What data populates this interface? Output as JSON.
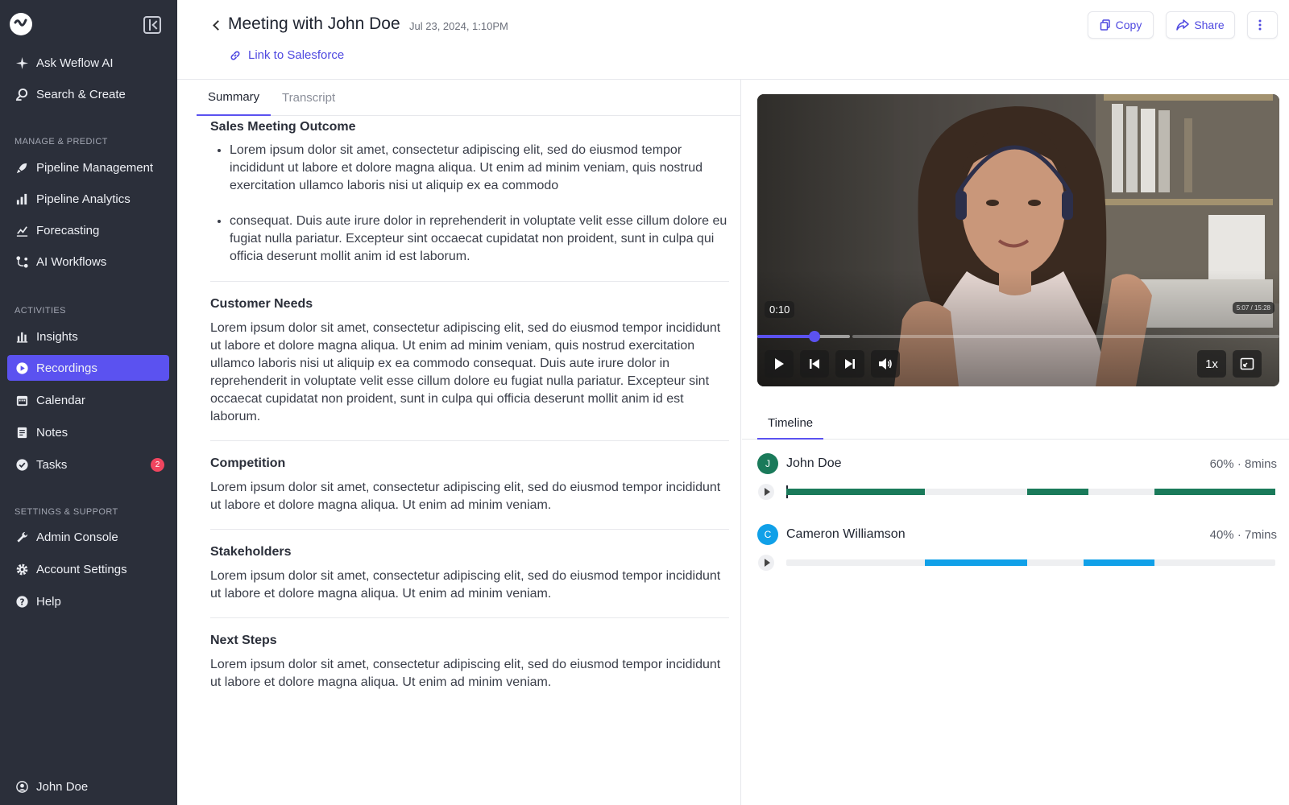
{
  "brand": {
    "accent": "#5b52f0",
    "sidebar_bg": "#2b2f3a"
  },
  "sidebar": {
    "top_items": [
      {
        "label": "Ask Weflow AI",
        "icon": "sparkle-icon"
      },
      {
        "label": "Search & Create",
        "icon": "search-create-icon"
      }
    ],
    "section_manage": "MANAGE & PREDICT",
    "manage_items": [
      {
        "label": "Pipeline Management",
        "icon": "rocket-icon"
      },
      {
        "label": "Pipeline Analytics",
        "icon": "analytics-icon"
      },
      {
        "label": "Forecasting",
        "icon": "forecast-icon"
      },
      {
        "label": "AI Workflows",
        "icon": "workflow-icon"
      }
    ],
    "section_activities": "ACTIVITIES",
    "activity_items": [
      {
        "label": "Insights",
        "icon": "bar-chart-icon"
      },
      {
        "label": "Recordings",
        "icon": "play-circle-icon",
        "active": true
      },
      {
        "label": "Calendar",
        "icon": "calendar-icon"
      },
      {
        "label": "Notes",
        "icon": "notes-icon"
      },
      {
        "label": "Tasks",
        "icon": "check-circle-icon",
        "badge": "2"
      }
    ],
    "section_settings": "SETTINGS & SUPPORT",
    "settings_items": [
      {
        "label": "Admin Console",
        "icon": "wrench-icon"
      },
      {
        "label": "Account Settings",
        "icon": "gear-icon"
      },
      {
        "label": "Help",
        "icon": "help-icon"
      }
    ],
    "user": "John Doe"
  },
  "header": {
    "title": "Meeting with John Doe",
    "date": "Jul 23, 2024, 1:10PM",
    "link": "Link to Salesforce",
    "copy_label": "Copy",
    "share_label": "Share"
  },
  "tabs": {
    "summary": "Summary",
    "transcript": "Transcript"
  },
  "summary": {
    "outcome_title": "Sales Meeting Outcome",
    "outcome_bullets": [
      "Lorem ipsum dolor sit amet, consectetur adipiscing elit, sed do eiusmod tempor incididunt ut labore et dolore magna aliqua. Ut enim ad minim veniam, quis nostrud exercitation ullamco laboris nisi ut aliquip ex ea commodo",
      "consequat. Duis aute irure dolor in reprehenderit in voluptate velit esse cillum dolore eu fugiat nulla pariatur. Excepteur sint occaecat cupidatat non proident, sunt in culpa qui officia deserunt mollit anim id est laborum."
    ],
    "needs_title": "Customer Needs",
    "needs_text": "Lorem ipsum dolor sit amet, consectetur adipiscing elit, sed do eiusmod tempor incididunt ut labore et dolore magna aliqua. Ut enim ad minim veniam, quis nostrud exercitation ullamco laboris nisi ut aliquip ex ea commodo consequat. Duis aute irure dolor in reprehenderit in voluptate velit esse cillum dolore eu fugiat nulla pariatur. Excepteur sint occaecat cupidatat non proident, sunt in culpa qui officia deserunt mollit anim id est laborum.",
    "competition_title": "Competition",
    "competition_text": "Lorem ipsum dolor sit amet, consectetur adipiscing elit, sed do eiusmod tempor incididunt ut labore et dolore magna aliqua. Ut enim ad minim veniam.",
    "stakeholders_title": "Stakeholders",
    "stakeholders_text": "Lorem ipsum dolor sit amet, consectetur adipiscing elit, sed do eiusmod tempor incididunt ut labore et dolore magna aliqua. Ut enim ad minim veniam.",
    "next_title": "Next Steps",
    "next_text": "Lorem ipsum dolor sit amet, consectetur adipiscing elit, sed do eiusmod tempor incididunt ut labore et dolore magna aliqua. Ut enim ad minim veniam."
  },
  "video": {
    "current_time": "0:10",
    "duration": "5:07 / 15:28",
    "speed": "1x",
    "progress": 0.11
  },
  "timeline": {
    "tab": "Timeline",
    "speakers": [
      {
        "initial": "J",
        "name": "John Doe",
        "stat": "60% · 8mins",
        "color": "#1a7a5a",
        "segments": [
          [
            0.0,
            0.283
          ],
          [
            0.493,
            0.618
          ],
          [
            0.753,
            1.0
          ]
        ]
      },
      {
        "initial": "C",
        "name": "Cameron Williamson",
        "stat": "40% · 7mins",
        "color": "#10a0e8",
        "segments": [
          [
            0.283,
            0.493
          ],
          [
            0.608,
            0.753
          ]
        ]
      }
    ]
  }
}
